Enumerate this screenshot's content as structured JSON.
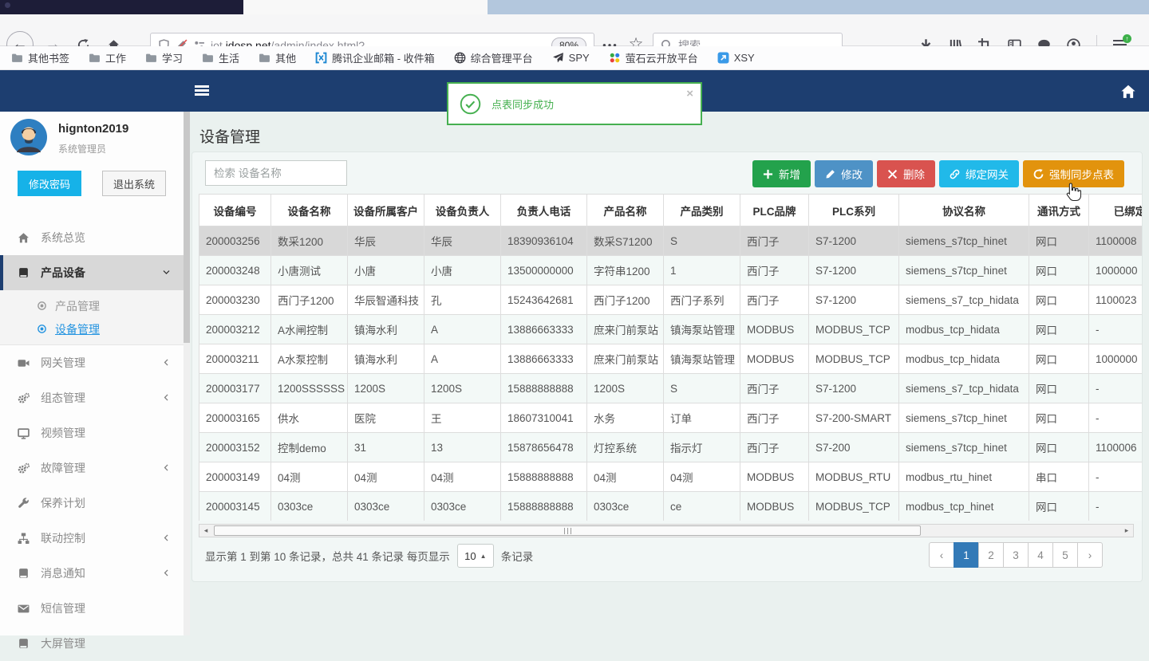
{
  "browser": {
    "url_sub": "iot.",
    "url_domain": "idosp.net",
    "url_path": "/admin/index.html?",
    "zoom": "80%",
    "dots": "•••",
    "star": "☆",
    "search_placeholder": "搜索",
    "bookmarks": [
      {
        "icon": "folder",
        "label": "其他书签"
      },
      {
        "icon": "folder",
        "label": "工作"
      },
      {
        "icon": "folder",
        "label": "学习"
      },
      {
        "icon": "folder",
        "label": "生活"
      },
      {
        "icon": "folder",
        "label": "其他"
      },
      {
        "icon": "tencent-mail",
        "label": "腾讯企业邮箱 - 收件箱"
      },
      {
        "icon": "globe",
        "label": "综合管理平台"
      },
      {
        "icon": "plane",
        "label": "SPY"
      },
      {
        "icon": "dots4",
        "label": "萤石云开放平台"
      },
      {
        "icon": "xsy",
        "label": "XSY"
      }
    ]
  },
  "toast": {
    "message": "点表同步成功",
    "close": "×"
  },
  "sidebar": {
    "username": "hignton2019",
    "role": "系统管理员",
    "change_password": "修改密码",
    "logout": "退出系统",
    "menu": [
      {
        "icon": "home",
        "label": "系统总览"
      },
      {
        "icon": "book",
        "label": "产品设备",
        "active": true,
        "chevron": "down",
        "children": [
          {
            "icon": "dot",
            "label": "产品管理"
          },
          {
            "icon": "dot",
            "label": "设备管理",
            "active": true
          }
        ]
      },
      {
        "icon": "camera",
        "label": "网关管理",
        "chevron": "left"
      },
      {
        "icon": "gears",
        "label": "组态管理",
        "chevron": "left"
      },
      {
        "icon": "monitor",
        "label": "视频管理"
      },
      {
        "icon": "gears",
        "label": "故障管理",
        "chevron": "left"
      },
      {
        "icon": "wrench",
        "label": "保养计划"
      },
      {
        "icon": "sitemap",
        "label": "联动控制",
        "chevron": "left"
      },
      {
        "icon": "book",
        "label": "消息通知",
        "chevron": "left"
      },
      {
        "icon": "envelope",
        "label": "短信管理"
      },
      {
        "icon": "book",
        "label": "大屏管理"
      }
    ]
  },
  "main": {
    "title": "设备管理",
    "search_placeholder": "检索 设备名称",
    "actions": [
      {
        "icon": "plus",
        "label": "新增",
        "color": "#23a24c"
      },
      {
        "icon": "pencil",
        "label": "修改",
        "color": "#4e92c6"
      },
      {
        "icon": "x",
        "label": "删除",
        "color": "#d9534f"
      },
      {
        "icon": "link",
        "label": "绑定网关",
        "color": "#21b9e9"
      },
      {
        "icon": "refresh",
        "label": "强制同步点表",
        "color": "#e2930d"
      }
    ],
    "table": {
      "headers": [
        "设备编号",
        "设备名称",
        "设备所属客户",
        "设备负责人",
        "负责人电话",
        "产品名称",
        "产品类别",
        "PLC品牌",
        "PLC系列",
        "协议名称",
        "通讯方式",
        "已绑定网关"
      ],
      "rows": [
        [
          "200003256",
          "数采1200",
          "华辰",
          "华辰",
          "18390936104",
          "数采S71200",
          "S",
          "西门子",
          "S7-1200",
          "siemens_s7tcp_hinet",
          "网口",
          "1100008"
        ],
        [
          "200003248",
          "小唐测试",
          "小唐",
          "小唐",
          "13500000000",
          "字符串1200",
          "1",
          "西门子",
          "S7-1200",
          "siemens_s7tcp_hinet",
          "网口",
          "1000000"
        ],
        [
          "200003230",
          "西门子1200",
          "华辰智通科技",
          "孔",
          "15243642681",
          "西门子1200",
          "西门子系列",
          "西门子",
          "S7-1200",
          "siemens_s7_tcp_hidata",
          "网口",
          "1100023"
        ],
        [
          "200003212",
          "A水闸控制",
          "镇海水利",
          "A",
          "13886663333",
          "庶来门前泵站",
          "镇海泵站管理",
          "MODBUS",
          "MODBUS_TCP",
          "modbus_tcp_hidata",
          "网口",
          "-"
        ],
        [
          "200003211",
          "A水泵控制",
          "镇海水利",
          "A",
          "13886663333",
          "庶来门前泵站",
          "镇海泵站管理",
          "MODBUS",
          "MODBUS_TCP",
          "modbus_tcp_hidata",
          "网口",
          "1000000"
        ],
        [
          "200003177",
          "1200SSSSSS",
          "1200S",
          "1200S",
          "15888888888",
          "1200S",
          "S",
          "西门子",
          "S7-1200",
          "siemens_s7_tcp_hidata",
          "网口",
          "-"
        ],
        [
          "200003165",
          "供水",
          "医院",
          "王",
          "18607310041",
          "水务",
          "订单",
          "西门子",
          "S7-200-SMART",
          "siemens_s7tcp_hinet",
          "网口",
          "-"
        ],
        [
          "200003152",
          "控制demo",
          "31",
          "13",
          "15878656478",
          "灯控系统",
          "指示灯",
          "西门子",
          "S7-200",
          "siemens_s7tcp_hinet",
          "网口",
          "1100006"
        ],
        [
          "200003149",
          "04测",
          "04测",
          "04测",
          "15888888888",
          "04测",
          "04测",
          "MODBUS",
          "MODBUS_RTU",
          "modbus_rtu_hinet",
          "串口",
          "-"
        ],
        [
          "200003145",
          "0303ce",
          "0303ce",
          "0303ce",
          "15888888888",
          "0303ce",
          "ce",
          "MODBUS",
          "MODBUS_TCP",
          "modbus_tcp_hinet",
          "网口",
          "-"
        ]
      ]
    },
    "pagination": {
      "info": "显示第 1 到第 10 条记录，总共 41 条记录 每页显示",
      "page_size": "10",
      "suffix": "条记录",
      "prev": "‹",
      "next": "›",
      "pages": [
        "1",
        "2",
        "3",
        "4",
        "5"
      ],
      "active": "1"
    },
    "scrollbar": {
      "left": "◂",
      "right": "▸"
    }
  }
}
